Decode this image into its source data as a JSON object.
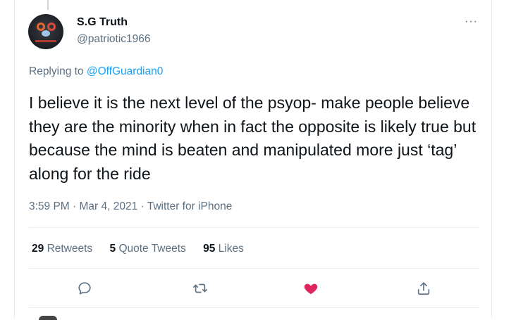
{
  "author": {
    "display_name": "S.G Truth",
    "handle": "@patriotic1966"
  },
  "reply": {
    "prefix": "Replying to ",
    "mention": "@OffGuardian0"
  },
  "tweet": {
    "text": "I believe it is the next level of the psyop- make people believe they are the minority when in fact the opposite is likely true but because the mind is beaten and manipulated more just ‘tag’ along for the ride"
  },
  "meta": "3:59 PM · Mar 4, 2021 · Twitter for iPhone",
  "stats": {
    "retweets_count": "29",
    "retweets_label": "Retweets",
    "quotes_count": "5",
    "quotes_label": "Quote Tweets",
    "likes_count": "95",
    "likes_label": "Likes"
  },
  "more_glyph": "···",
  "icons": {
    "reply": "reply-icon",
    "retweet": "retweet-icon",
    "like": "heart-icon",
    "share": "share-icon"
  },
  "colors": {
    "accent": "#1da1f2",
    "like_active": "#e0245e",
    "secondary_text": "#5b7083"
  }
}
